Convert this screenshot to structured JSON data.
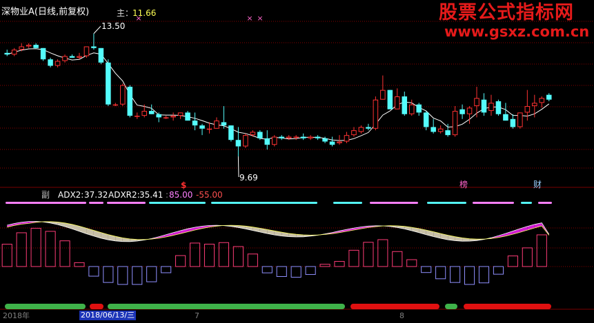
{
  "chart_title": "深物业A(日线,前复权)",
  "main_label": "主：",
  "main_value": "11.66",
  "price_high_label": "13.50",
  "price_low_label": "9.69",
  "watermark": {
    "line1": "股票公式指标网",
    "line2": "www.gsxz.com.cn"
  },
  "event_markers": [
    {
      "label": "$",
      "color": "#ff3030"
    },
    {
      "label": "榜",
      "color": "#ff66cc"
    },
    {
      "label": "财",
      "color": "#9ad0ff"
    }
  ],
  "sub_panel": {
    "name": "副",
    "adx2_label": "ADX2:",
    "adx2_value": "37.32",
    "adxr2_label": "ADXR2:",
    "adxr2_value": "35.41",
    "level_high": "85.00",
    "level_low": "-55.00"
  },
  "date_axis": {
    "year_label": "2018年",
    "cursor_date": "2018/06/13/三",
    "mark_7": "7",
    "mark_8": "8"
  },
  "colors": {
    "up": "#ff3232",
    "down": "#54fcfc",
    "ma": "#ffffff",
    "adx_fill_pos": "#d21ed2",
    "adx_fill_neg": "#c8c0a8",
    "hist_pos": "#ff3c78",
    "hist_neg": "#9090ff",
    "stripe_cyan": "#54fcfc",
    "stripe_pink": "#ff80ff",
    "bar_green": "#3fb24a",
    "bar_red": "#e01010",
    "grid": "#8b0000"
  },
  "chart_data": {
    "type": "candlestick",
    "title": "深物业A(日线,前复权)",
    "xlabel": "",
    "ylabel": "",
    "ohlc": [
      [
        12.9,
        13.0,
        12.8,
        12.85
      ],
      [
        12.85,
        13.05,
        12.8,
        13.0
      ],
      [
        13.0,
        13.2,
        12.95,
        13.1
      ],
      [
        13.1,
        13.2,
        13.05,
        13.15
      ],
      [
        13.15,
        13.2,
        13.05,
        13.05
      ],
      [
        13.05,
        13.05,
        12.65,
        12.7
      ],
      [
        12.7,
        12.75,
        12.45,
        12.5
      ],
      [
        12.5,
        12.7,
        12.45,
        12.65
      ],
      [
        12.65,
        12.85,
        12.6,
        12.8
      ],
      [
        12.8,
        12.85,
        12.75,
        12.75
      ],
      [
        12.75,
        12.9,
        12.7,
        12.8
      ],
      [
        12.8,
        13.1,
        12.75,
        13.1
      ],
      [
        13.1,
        13.5,
        13.0,
        13.05
      ],
      [
        13.05,
        13.05,
        12.55,
        12.6
      ],
      [
        12.6,
        12.7,
        11.25,
        11.3
      ],
      [
        11.3,
        11.35,
        11.25,
        11.3
      ],
      [
        11.3,
        11.95,
        11.25,
        11.9
      ],
      [
        11.85,
        11.9,
        10.9,
        10.95
      ],
      [
        10.95,
        11.05,
        10.85,
        10.95
      ],
      [
        10.95,
        11.3,
        10.9,
        11.1
      ],
      [
        11.1,
        11.3,
        11.0,
        11.0
      ],
      [
        11.0,
        11.05,
        10.75,
        10.9
      ],
      [
        10.9,
        10.95,
        10.85,
        10.9
      ],
      [
        10.9,
        11.05,
        10.8,
        10.95
      ],
      [
        10.95,
        11.05,
        10.85,
        11.05
      ],
      [
        11.05,
        11.1,
        10.8,
        10.8
      ],
      [
        10.8,
        11.05,
        10.5,
        10.65
      ],
      [
        10.65,
        10.7,
        10.35,
        10.55
      ],
      [
        10.55,
        10.75,
        10.4,
        10.55
      ],
      [
        10.55,
        10.9,
        10.55,
        10.8
      ],
      [
        10.75,
        11.25,
        10.55,
        10.65
      ],
      [
        10.65,
        10.65,
        10.15,
        10.2
      ],
      [
        10.2,
        10.6,
        9.69,
        10.0
      ],
      [
        10.0,
        10.4,
        9.95,
        10.35
      ],
      [
        10.35,
        10.5,
        10.3,
        10.45
      ],
      [
        10.45,
        10.5,
        10.2,
        10.25
      ],
      [
        10.25,
        10.5,
        9.9,
        10.05
      ],
      [
        10.05,
        10.35,
        10.0,
        10.3
      ],
      [
        10.3,
        10.35,
        10.2,
        10.25
      ],
      [
        10.25,
        10.35,
        10.2,
        10.3
      ],
      [
        10.3,
        10.35,
        10.2,
        10.3
      ],
      [
        10.3,
        10.4,
        10.2,
        10.25
      ],
      [
        10.25,
        10.35,
        10.2,
        10.3
      ],
      [
        10.3,
        10.35,
        10.2,
        10.25
      ],
      [
        10.25,
        10.3,
        10.1,
        10.15
      ],
      [
        10.15,
        10.3,
        10.0,
        10.05
      ],
      [
        10.1,
        10.35,
        10.05,
        10.15
      ],
      [
        10.15,
        10.45,
        10.1,
        10.35
      ],
      [
        10.35,
        10.6,
        10.3,
        10.5
      ],
      [
        10.45,
        10.65,
        10.4,
        10.6
      ],
      [
        10.6,
        10.7,
        10.5,
        10.55
      ],
      [
        10.55,
        11.55,
        10.5,
        11.45
      ],
      [
        11.45,
        12.2,
        11.45,
        11.75
      ],
      [
        11.75,
        11.75,
        11.2,
        11.15
      ],
      [
        11.15,
        11.8,
        11.15,
        11.55
      ],
      [
        11.55,
        11.7,
        10.95,
        11.0
      ],
      [
        11.0,
        11.45,
        10.95,
        11.3
      ],
      [
        11.3,
        11.35,
        10.95,
        11.05
      ],
      [
        11.05,
        11.1,
        10.5,
        10.6
      ],
      [
        10.6,
        10.85,
        10.4,
        10.45
      ],
      [
        10.45,
        10.65,
        10.4,
        10.55
      ],
      [
        10.5,
        10.7,
        10.3,
        10.35
      ],
      [
        10.35,
        11.25,
        10.3,
        11.1
      ],
      [
        11.15,
        11.3,
        10.85,
        11.0
      ],
      [
        11.0,
        11.25,
        10.7,
        11.2
      ],
      [
        11.25,
        11.85,
        10.9,
        11.5
      ],
      [
        11.45,
        11.65,
        10.95,
        11.05
      ],
      [
        11.1,
        11.6,
        10.95,
        11.35
      ],
      [
        11.4,
        11.45,
        10.95,
        11.0
      ],
      [
        11.0,
        11.35,
        10.8,
        10.8
      ],
      [
        10.85,
        11.0,
        10.55,
        10.6
      ],
      [
        10.6,
        11.05,
        10.55,
        11.05
      ],
      [
        11.05,
        11.75,
        10.8,
        11.25
      ],
      [
        11.25,
        11.6,
        10.9,
        11.35
      ],
      [
        11.35,
        11.55,
        11.2,
        11.5
      ],
      [
        11.6,
        11.65,
        11.4,
        11.45
      ]
    ],
    "ylim": [
      9.2,
      13.9
    ],
    "indicator": {
      "name": "ADX2/ADXR2",
      "adx2_last": 37.32,
      "adxr2_last": 35.41,
      "ylim": [
        -70,
        100
      ],
      "levels": [
        85.0,
        -55.0
      ]
    }
  }
}
